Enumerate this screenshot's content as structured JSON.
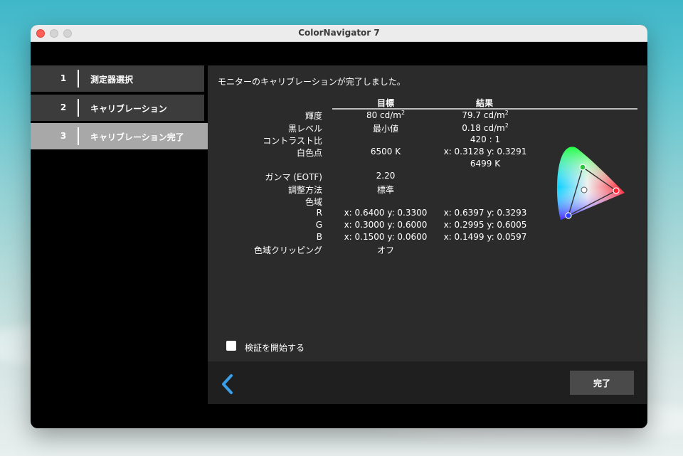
{
  "window": {
    "title": "ColorNavigator 7"
  },
  "steps": [
    {
      "num": "1",
      "label": "測定器選択"
    },
    {
      "num": "2",
      "label": "キャリブレーション"
    },
    {
      "num": "3",
      "label": "キャリブレーション完了"
    }
  ],
  "panel": {
    "heading": "モニターのキャリブレーションが完了しました。",
    "col_target": "目標",
    "col_result": "結果",
    "rows": [
      {
        "label": "輝度",
        "target": "80 cd/m",
        "target_sup": "2",
        "result": "79.7 cd/m",
        "result_sup": "2"
      },
      {
        "label": "黒レベル",
        "target": "最小値",
        "result": "0.18 cd/m",
        "result_sup": "2"
      },
      {
        "label": "コントラスト比",
        "target": "",
        "result": "420 : 1"
      },
      {
        "label": "白色点",
        "target": "6500 K",
        "result": "x: 0.3128  y: 0.3291",
        "result2": "6499 K"
      },
      {
        "label": "ガンマ (EOTF)",
        "target": "2.20",
        "result": ""
      },
      {
        "label": "調整方法",
        "target": "標準",
        "result": ""
      },
      {
        "label": "色域",
        "target": "",
        "result": ""
      },
      {
        "label": "R",
        "target": "x: 0.6400  y: 0.3300",
        "result": "x: 0.6397  y: 0.3293"
      },
      {
        "label": "G",
        "target": "x: 0.3000  y: 0.6000",
        "result": "x: 0.2995  y: 0.6005"
      },
      {
        "label": "B",
        "target": "x: 0.1500  y: 0.0600",
        "result": "x: 0.1499  y: 0.0597"
      },
      {
        "label": "色域クリッピング",
        "target": "オフ",
        "result": ""
      }
    ],
    "verify_label": "検証を開始する"
  },
  "footer": {
    "done_label": "完了"
  },
  "colors": {
    "step_active": "#a8a8a8",
    "step_inactive": "#3c3c3c",
    "panel_bg": "#2b2b2b",
    "accent_back": "#3a9ee8"
  }
}
